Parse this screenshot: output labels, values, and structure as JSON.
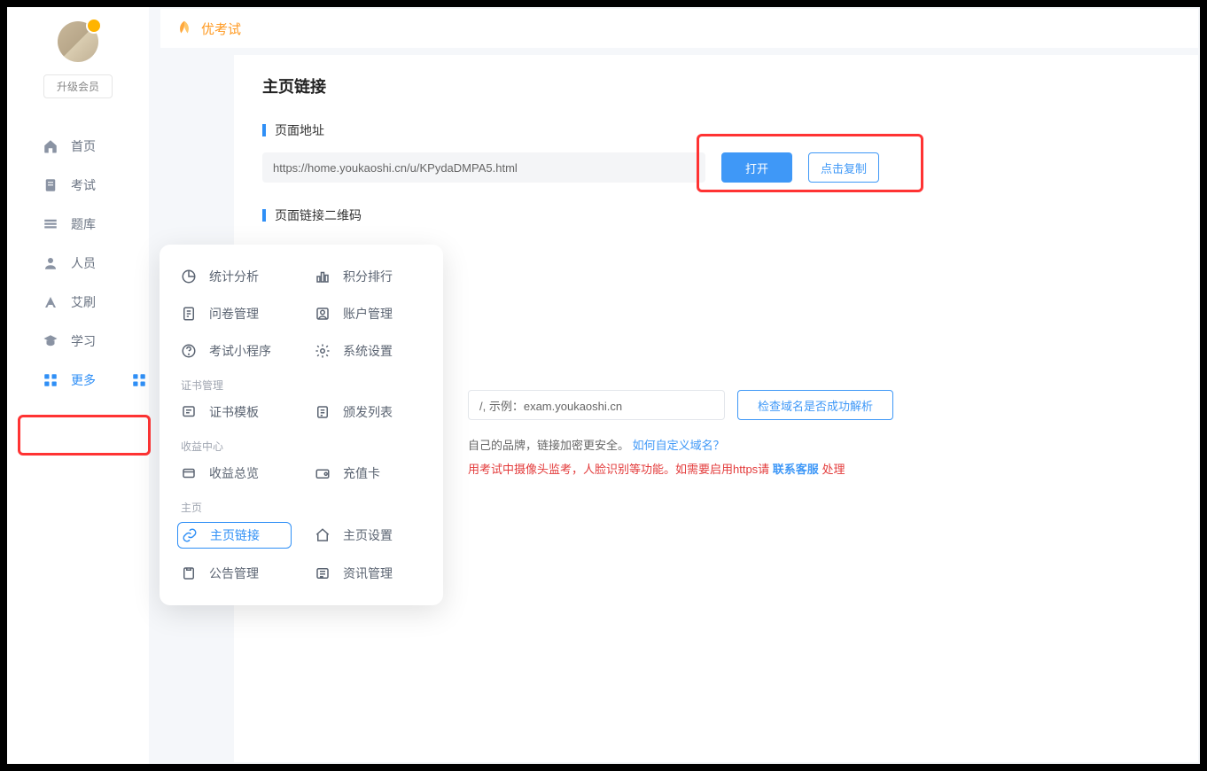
{
  "colors": {
    "accent": "#2f8ff6",
    "warning": "#e33b3b",
    "brand": "#ff9a22",
    "highlight": "#ff3333"
  },
  "sidebar": {
    "upgrade_label": "升级会员",
    "items": [
      {
        "label": "首页",
        "icon": "home-icon"
      },
      {
        "label": "考试",
        "icon": "exam-icon"
      },
      {
        "label": "题库",
        "icon": "question-bank-icon"
      },
      {
        "label": "人员",
        "icon": "people-icon"
      },
      {
        "label": "艾刷",
        "icon": "aishua-icon"
      },
      {
        "label": "学习",
        "icon": "study-icon"
      },
      {
        "label": "更多",
        "icon": "more-icon",
        "active": true
      }
    ]
  },
  "header": {
    "brand": "优考试"
  },
  "page": {
    "title": "主页链接",
    "sections": {
      "url": {
        "title": "页面地址",
        "value": "https://home.youkaoshi.cn/u/KPydaDMPA5.html",
        "open_label": "打开",
        "copy_label": "点击复制"
      },
      "qrcode": {
        "title": "页面链接二维码"
      }
    },
    "domain": {
      "placeholder_suffix": "/, 示例：exam.youkaoshi.cn",
      "check_label": "检查域名是否成功解析",
      "help_line_tail": "自己的品牌，链接加密更安全。",
      "help_link": "如何自定义域名？",
      "warn_tail": "用考试中摄像头监考，人脸识别等功能。如需要启用https请 ",
      "warn_link": "联系客服",
      "warn_suffix": " 处理"
    }
  },
  "popover": {
    "general": [
      {
        "label": "统计分析",
        "icon": "chart-pie-icon"
      },
      {
        "label": "积分排行",
        "icon": "ranking-icon"
      },
      {
        "label": "问卷管理",
        "icon": "survey-icon"
      },
      {
        "label": "账户管理",
        "icon": "account-icon"
      },
      {
        "label": "考试小程序",
        "icon": "miniapp-icon"
      },
      {
        "label": "系统设置",
        "icon": "settings-icon"
      }
    ],
    "cert_section": "证书管理",
    "cert": [
      {
        "label": "证书模板",
        "icon": "cert-template-icon"
      },
      {
        "label": "颁发列表",
        "icon": "cert-list-icon"
      }
    ],
    "revenue_section": "收益中心",
    "revenue": [
      {
        "label": "收益总览",
        "icon": "revenue-icon"
      },
      {
        "label": "充值卡",
        "icon": "recharge-icon"
      }
    ],
    "home_section": "主页",
    "home": [
      {
        "label": "主页链接",
        "icon": "link-icon",
        "active": true
      },
      {
        "label": "主页设置",
        "icon": "home-settings-icon"
      },
      {
        "label": "公告管理",
        "icon": "announcement-icon"
      },
      {
        "label": "资讯管理",
        "icon": "news-icon"
      }
    ]
  }
}
